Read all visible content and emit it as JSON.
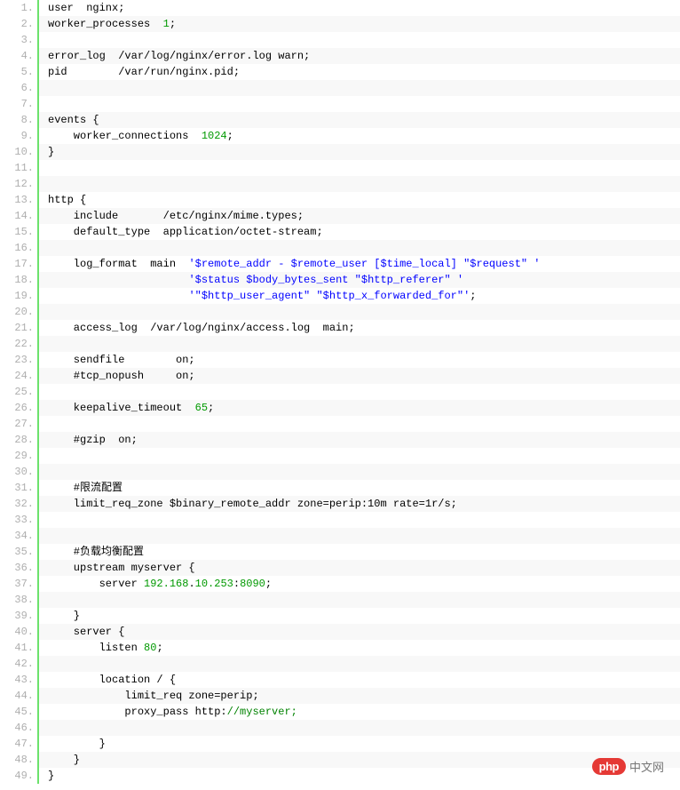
{
  "watermark": {
    "badge": "php",
    "text": "中文网"
  },
  "code": {
    "lines": [
      {
        "n": 1,
        "tokens": [
          {
            "t": "user  nginx;",
            "c": "pl"
          }
        ]
      },
      {
        "n": 2,
        "tokens": [
          {
            "t": "worker_processes  ",
            "c": "pl"
          },
          {
            "t": "1",
            "c": "num"
          },
          {
            "t": ";",
            "c": "pl"
          }
        ]
      },
      {
        "n": 3,
        "tokens": []
      },
      {
        "n": 4,
        "tokens": [
          {
            "t": "error_log  /var/log/nginx/error.log warn;",
            "c": "pl"
          }
        ]
      },
      {
        "n": 5,
        "tokens": [
          {
            "t": "pid        /var/run/nginx.pid;",
            "c": "pl"
          }
        ]
      },
      {
        "n": 6,
        "tokens": []
      },
      {
        "n": 7,
        "tokens": []
      },
      {
        "n": 8,
        "tokens": [
          {
            "t": "events {",
            "c": "pl"
          }
        ]
      },
      {
        "n": 9,
        "tokens": [
          {
            "t": "    worker_connections  ",
            "c": "pl"
          },
          {
            "t": "1024",
            "c": "num"
          },
          {
            "t": ";",
            "c": "pl"
          }
        ]
      },
      {
        "n": 10,
        "tokens": [
          {
            "t": "}",
            "c": "pl"
          }
        ]
      },
      {
        "n": 11,
        "tokens": []
      },
      {
        "n": 12,
        "tokens": []
      },
      {
        "n": 13,
        "tokens": [
          {
            "t": "http {",
            "c": "pl"
          }
        ]
      },
      {
        "n": 14,
        "tokens": [
          {
            "t": "    include       /etc/nginx/mime.types;",
            "c": "pl"
          }
        ]
      },
      {
        "n": 15,
        "tokens": [
          {
            "t": "    default_type  application/octet-stream;",
            "c": "pl"
          }
        ]
      },
      {
        "n": 16,
        "tokens": []
      },
      {
        "n": 17,
        "tokens": [
          {
            "t": "    log_format  main  ",
            "c": "pl"
          },
          {
            "t": "'$remote_addr - $remote_user [$time_local] \"$request\" '",
            "c": "str"
          }
        ]
      },
      {
        "n": 18,
        "tokens": [
          {
            "t": "                      ",
            "c": "pl"
          },
          {
            "t": "'$status $body_bytes_sent \"$http_referer\" '",
            "c": "str"
          }
        ]
      },
      {
        "n": 19,
        "tokens": [
          {
            "t": "                      ",
            "c": "pl"
          },
          {
            "t": "'\"$http_user_agent\" \"$http_x_forwarded_for\"'",
            "c": "str"
          },
          {
            "t": ";",
            "c": "pl"
          }
        ]
      },
      {
        "n": 20,
        "tokens": []
      },
      {
        "n": 21,
        "tokens": [
          {
            "t": "    access_log  /var/log/nginx/access.log  main;",
            "c": "pl"
          }
        ]
      },
      {
        "n": 22,
        "tokens": []
      },
      {
        "n": 23,
        "tokens": [
          {
            "t": "    sendfile        on;",
            "c": "pl"
          }
        ]
      },
      {
        "n": 24,
        "tokens": [
          {
            "t": "    #tcp_nopush     on;",
            "c": "pl"
          }
        ]
      },
      {
        "n": 25,
        "tokens": []
      },
      {
        "n": 26,
        "tokens": [
          {
            "t": "    keepalive_timeout  ",
            "c": "pl"
          },
          {
            "t": "65",
            "c": "num"
          },
          {
            "t": ";",
            "c": "pl"
          }
        ]
      },
      {
        "n": 27,
        "tokens": []
      },
      {
        "n": 28,
        "tokens": [
          {
            "t": "    #gzip  on;",
            "c": "pl"
          }
        ]
      },
      {
        "n": 29,
        "tokens": []
      },
      {
        "n": 30,
        "tokens": []
      },
      {
        "n": 31,
        "tokens": [
          {
            "t": "    #限流配置",
            "c": "pl"
          }
        ]
      },
      {
        "n": 32,
        "tokens": [
          {
            "t": "    limit_req_zone $binary_remote_addr zone=perip:10m rate=1r/s;",
            "c": "pl"
          }
        ]
      },
      {
        "n": 33,
        "tokens": []
      },
      {
        "n": 34,
        "tokens": []
      },
      {
        "n": 35,
        "tokens": [
          {
            "t": "    #负载均衡配置",
            "c": "pl"
          }
        ]
      },
      {
        "n": 36,
        "tokens": [
          {
            "t": "    upstream myserver {",
            "c": "pl"
          }
        ]
      },
      {
        "n": 37,
        "tokens": [
          {
            "t": "        server ",
            "c": "pl"
          },
          {
            "t": "192.168",
            "c": "ip"
          },
          {
            "t": ".",
            "c": "pl"
          },
          {
            "t": "10.253",
            "c": "ip"
          },
          {
            "t": ":",
            "c": "pl"
          },
          {
            "t": "8090",
            "c": "num"
          },
          {
            "t": ";",
            "c": "pl"
          }
        ]
      },
      {
        "n": 38,
        "tokens": []
      },
      {
        "n": 39,
        "tokens": [
          {
            "t": "    }",
            "c": "pl"
          }
        ]
      },
      {
        "n": 40,
        "tokens": [
          {
            "t": "    server {",
            "c": "pl"
          }
        ]
      },
      {
        "n": 41,
        "tokens": [
          {
            "t": "        listen ",
            "c": "pl"
          },
          {
            "t": "80",
            "c": "num"
          },
          {
            "t": ";",
            "c": "pl"
          }
        ]
      },
      {
        "n": 42,
        "tokens": []
      },
      {
        "n": 43,
        "tokens": [
          {
            "t": "        location / {",
            "c": "pl"
          }
        ]
      },
      {
        "n": 44,
        "tokens": [
          {
            "t": "            limit_req zone=perip;",
            "c": "pl"
          }
        ]
      },
      {
        "n": 45,
        "tokens": [
          {
            "t": "            proxy_pass http:",
            "c": "pl"
          },
          {
            "t": "//myserver;",
            "c": "url"
          }
        ]
      },
      {
        "n": 46,
        "tokens": []
      },
      {
        "n": 47,
        "tokens": [
          {
            "t": "        }",
            "c": "pl"
          }
        ]
      },
      {
        "n": 48,
        "tokens": [
          {
            "t": "    }",
            "c": "pl"
          }
        ]
      },
      {
        "n": 49,
        "tokens": [
          {
            "t": "}",
            "c": "pl"
          }
        ]
      }
    ]
  }
}
